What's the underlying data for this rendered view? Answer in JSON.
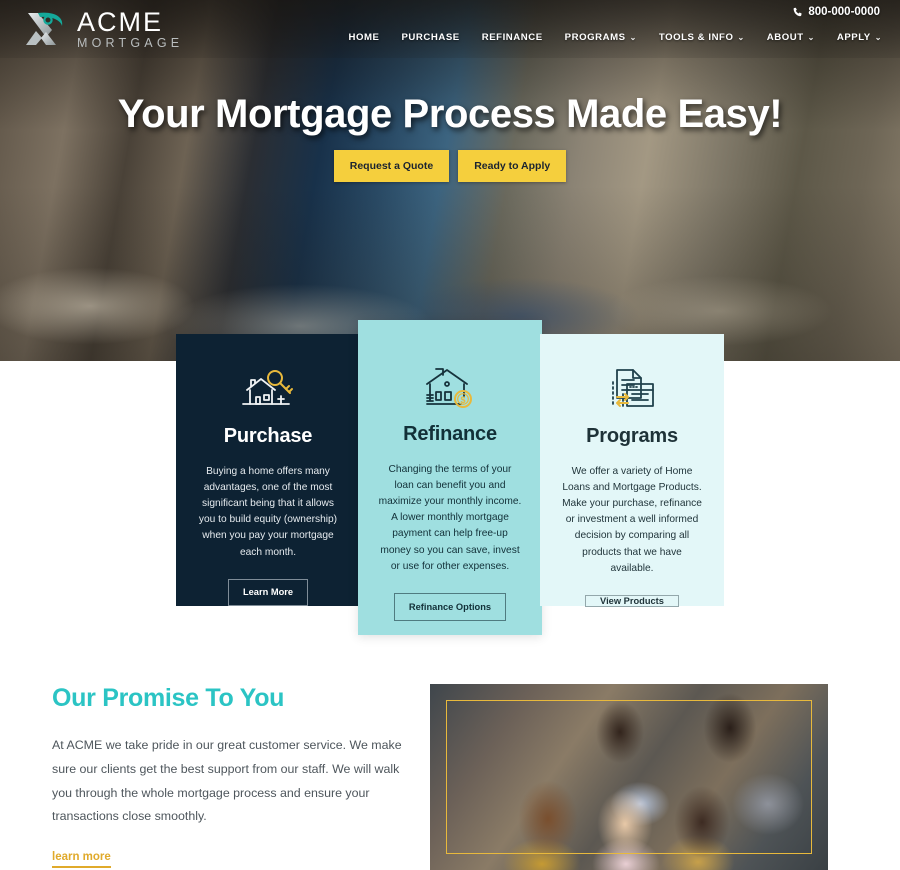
{
  "brand": {
    "name": "ACME",
    "subtitle": "MORTGAGE",
    "logo_icon": "acme-swoosh-logo",
    "accent_teal": "#2bc4c4",
    "accent_gold": "#f5cf3d",
    "dark_navy": "#0d2233"
  },
  "header": {
    "phone_icon": "phone-icon",
    "phone": "800-000-0000",
    "nav": [
      {
        "label": "HOME",
        "has_dropdown": false
      },
      {
        "label": "PURCHASE",
        "has_dropdown": false
      },
      {
        "label": "REFINANCE",
        "has_dropdown": false
      },
      {
        "label": "PROGRAMS",
        "has_dropdown": true
      },
      {
        "label": "TOOLS & INFO",
        "has_dropdown": true
      },
      {
        "label": "ABOUT",
        "has_dropdown": true
      },
      {
        "label": "APPLY",
        "has_dropdown": true
      }
    ],
    "caret": "⌄"
  },
  "hero": {
    "title": "Your Mortgage Process Made Easy!",
    "buttons": [
      {
        "label": "Request a Quote"
      },
      {
        "label": "Ready to Apply"
      }
    ]
  },
  "cards": [
    {
      "key": "purchase",
      "icon": "house-with-key-icon",
      "title": "Purchase",
      "body": "Buying a home offers many advantages, one of the most significant being that it allows you to build equity (ownership) when you pay your mortgage each month.",
      "button": "Learn More",
      "background": "#0d2233"
    },
    {
      "key": "refinance",
      "icon": "house-with-dollar-coin-icon",
      "title": "Refinance",
      "body": "Changing the terms of your loan can benefit you and maximize your monthly income. A lower monthly mortgage payment can help free-up money so you can save, invest or use for other expenses.",
      "button": "Refinance Options",
      "background": "#9fdfe0"
    },
    {
      "key": "programs",
      "icon": "documents-compare-icon",
      "title": "Programs",
      "body": "We offer a variety of Home Loans and Mortgage Products. Make your purchase, refinance or investment a well informed decision by comparing all products that we have available.",
      "button": "View Products",
      "background": "#e3f7f8"
    }
  ],
  "promise": {
    "title": "Our Promise To You",
    "text": "At ACME we take pride in our great customer service. We make sure our clients get the best support from our staff. We will walk you through the whole mortgage process and ensure your transactions close smoothly.",
    "link": "learn more",
    "photo_alt": "team-celebrating-photo"
  }
}
